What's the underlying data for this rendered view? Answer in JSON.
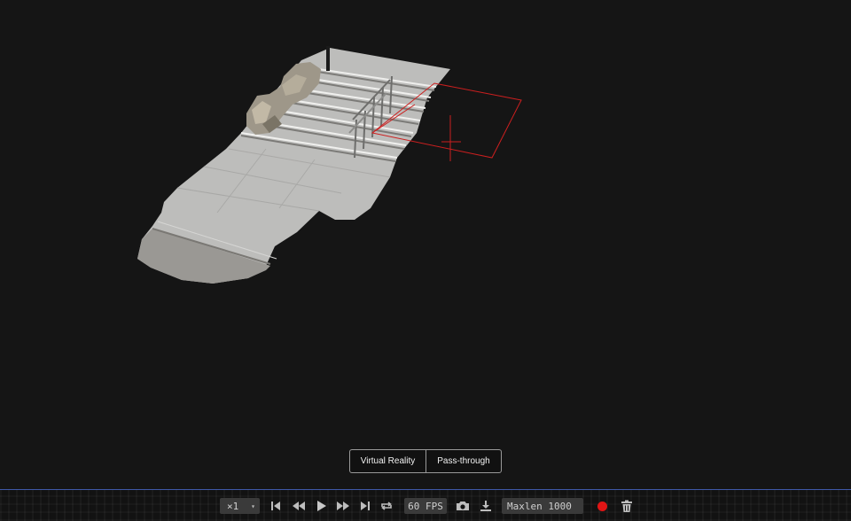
{
  "xr": {
    "vr_label": "Virtual Reality",
    "passthrough_label": "Pass-through"
  },
  "controls": {
    "speed_value": "×1",
    "fps_label": "60 FPS",
    "maxlen_value": "Maxlen 1000"
  },
  "colors": {
    "background": "#151515",
    "recording": "#e01515",
    "camera_frustum": "#cc1f1f"
  },
  "icons": [
    "skip-start-icon",
    "rewind-icon",
    "play-icon",
    "fast-forward-icon",
    "skip-end-icon",
    "loop-icon",
    "camera-icon",
    "download-icon",
    "record-icon",
    "trash-icon"
  ]
}
